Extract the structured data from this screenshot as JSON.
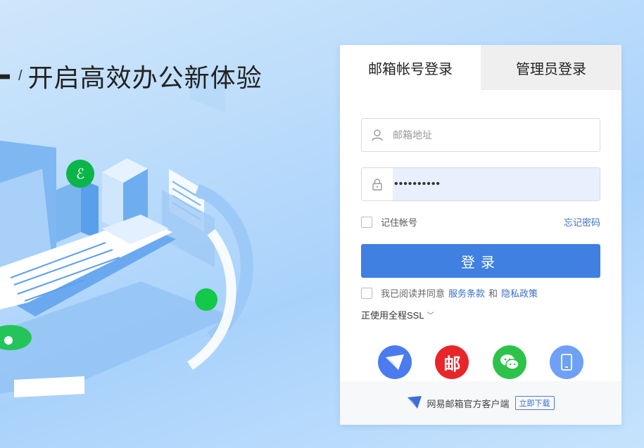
{
  "hero": {
    "slash": "/",
    "slogan": "开启高效办公新体验"
  },
  "tabs": [
    {
      "label": "邮箱帐号登录",
      "active": true
    },
    {
      "label": "管理员登录",
      "active": false
    }
  ],
  "form": {
    "email_placeholder": "邮箱地址",
    "email_value": "",
    "password_value": "••••••••••",
    "remember_label": "记住帐号",
    "forgot_label": "忘记密码",
    "login_label": "登录",
    "agree_prefix": "我已阅读并同意",
    "terms_label": "服务条款",
    "and_label": "和",
    "privacy_label": "隐私政策",
    "ssl_label": "正使用全程SSL",
    "ssl_chevron": "﹀"
  },
  "quick_login_icons": [
    {
      "name": "mail-master-icon",
      "color": "#4a7cf0"
    },
    {
      "name": "netease-mail-icon",
      "color": "#e8262a",
      "glyph": "邮"
    },
    {
      "name": "wechat-icon",
      "color": "#2dc24a"
    },
    {
      "name": "mobile-icon",
      "color": "#6ea0f5"
    }
  ],
  "footer": {
    "text": "网易邮箱官方客户端",
    "download_label": "立即下载"
  },
  "colors": {
    "primary": "#3f80e0",
    "link": "#3a6fc4"
  }
}
